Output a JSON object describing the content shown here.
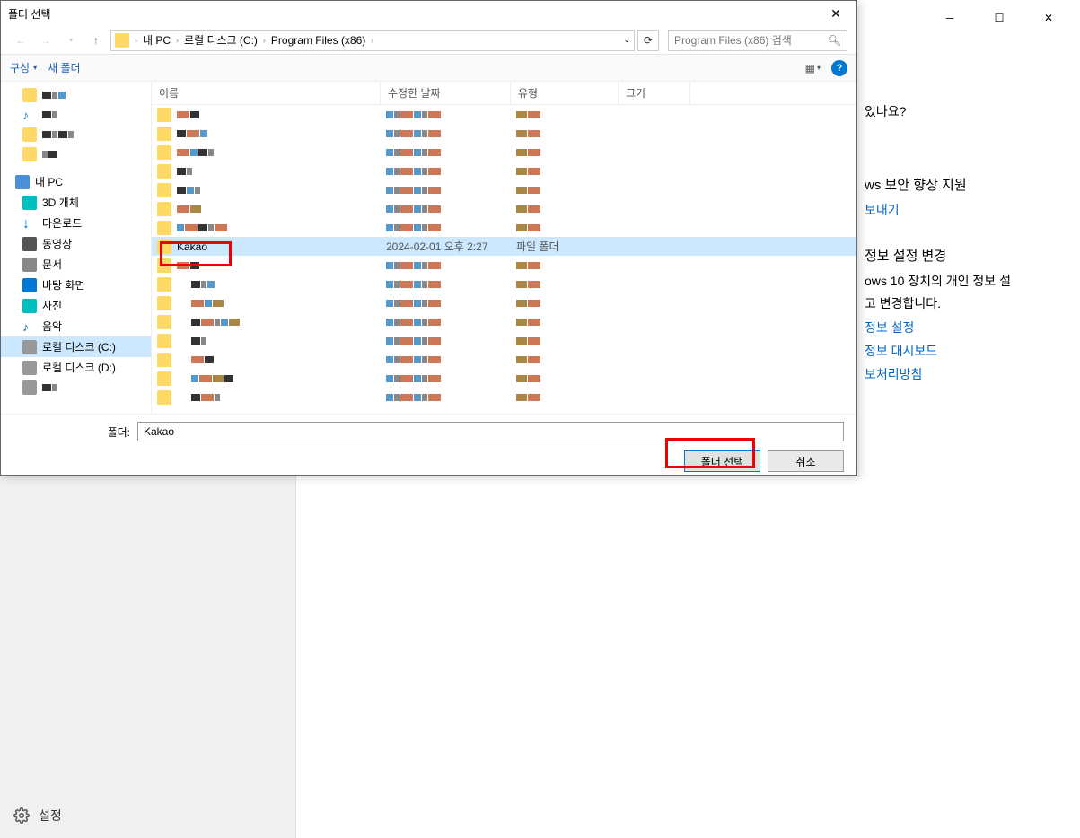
{
  "bg": {
    "q1": "있나요?",
    "h1": "ws 보안 향상 지원",
    "link1": "보내기",
    "h2": "정보 설정 변경",
    "t1": "ows 10 장치의 개인 정보 설",
    "t2": "고 변경합니다.",
    "link2": "정보 설정",
    "link3": "정보 대시보드",
    "link4": "보처리방침",
    "settings": "설정"
  },
  "dialog": {
    "title": "폴더 선택",
    "breadcrumb": {
      "c1": "내 PC",
      "c2": "로컬 디스크 (C:)",
      "c3": "Program Files (x86)"
    },
    "search_placeholder": "Program Files (x86) 검색",
    "toolbar": {
      "organize": "구성",
      "new_folder": "새 폴더"
    },
    "tree": {
      "pc": "내 PC",
      "obj3d": "3D 개체",
      "downloads": "다운로드",
      "videos": "동영상",
      "documents": "문서",
      "desktop": "바탕 화면",
      "pictures": "사진",
      "music": "음악",
      "disk_c": "로컬 디스크 (C:)",
      "disk_d": "로컬 디스크 (D:)"
    },
    "cols": {
      "name": "이름",
      "modified": "수정한 날짜",
      "type": "유형",
      "size": "크기"
    },
    "selected_row": {
      "name": "Kakao",
      "date": "2024-02-01 오후 2:27",
      "type": "파일 폴더"
    },
    "folder_label": "폴더:",
    "folder_value": "Kakao",
    "btn_select": "폴더 선택",
    "btn_cancel": "취소"
  }
}
